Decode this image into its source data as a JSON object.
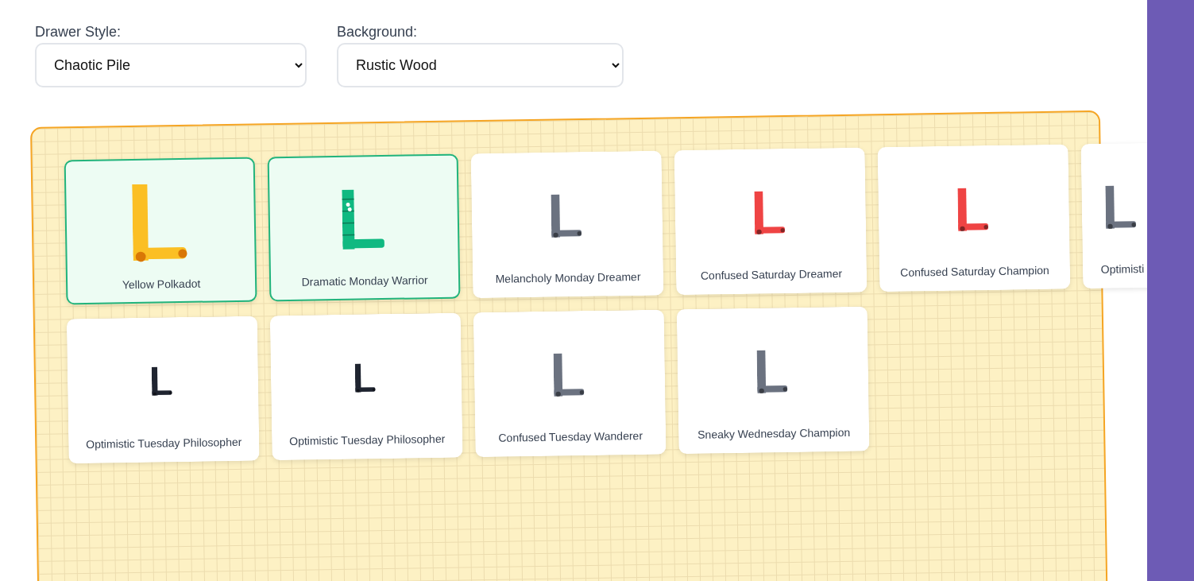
{
  "controls": [
    {
      "label": "Drawer Style:",
      "value": "Chaotic Pile"
    },
    {
      "label": "Background:",
      "value": "Rustic Wood"
    }
  ],
  "socks": [
    {
      "name": "Yellow Polkadot",
      "selected": true,
      "color": "#fbbf24",
      "kind": "polkadot"
    },
    {
      "name": "Dramatic Monday Warrior",
      "selected": true,
      "color": "#10b981",
      "kind": "striped"
    },
    {
      "name": "Melancholy Monday Dreamer",
      "selected": false,
      "color": "#6b7280",
      "kind": "plain"
    },
    {
      "name": "Confused Saturday Dreamer",
      "selected": false,
      "color": "#ef4444",
      "kind": "plain"
    },
    {
      "name": "Confused Saturday Champion",
      "selected": false,
      "color": "#ef4444",
      "kind": "plain"
    },
    {
      "name": "Optimisti",
      "selected": false,
      "color": "#6b7280",
      "kind": "plain"
    },
    {
      "name": "Optimistic Tuesday Philosopher",
      "selected": false,
      "color": "#1f2430",
      "kind": "mini"
    },
    {
      "name": "Optimistic Tuesday Philosopher",
      "selected": false,
      "color": "#1f2430",
      "kind": "mini"
    },
    {
      "name": "Confused Tuesday Wanderer",
      "selected": false,
      "color": "#6b7280",
      "kind": "plain"
    },
    {
      "name": "Sneaky Wednesday Champion",
      "selected": false,
      "color": "#6b7280",
      "kind": "plain"
    }
  ]
}
